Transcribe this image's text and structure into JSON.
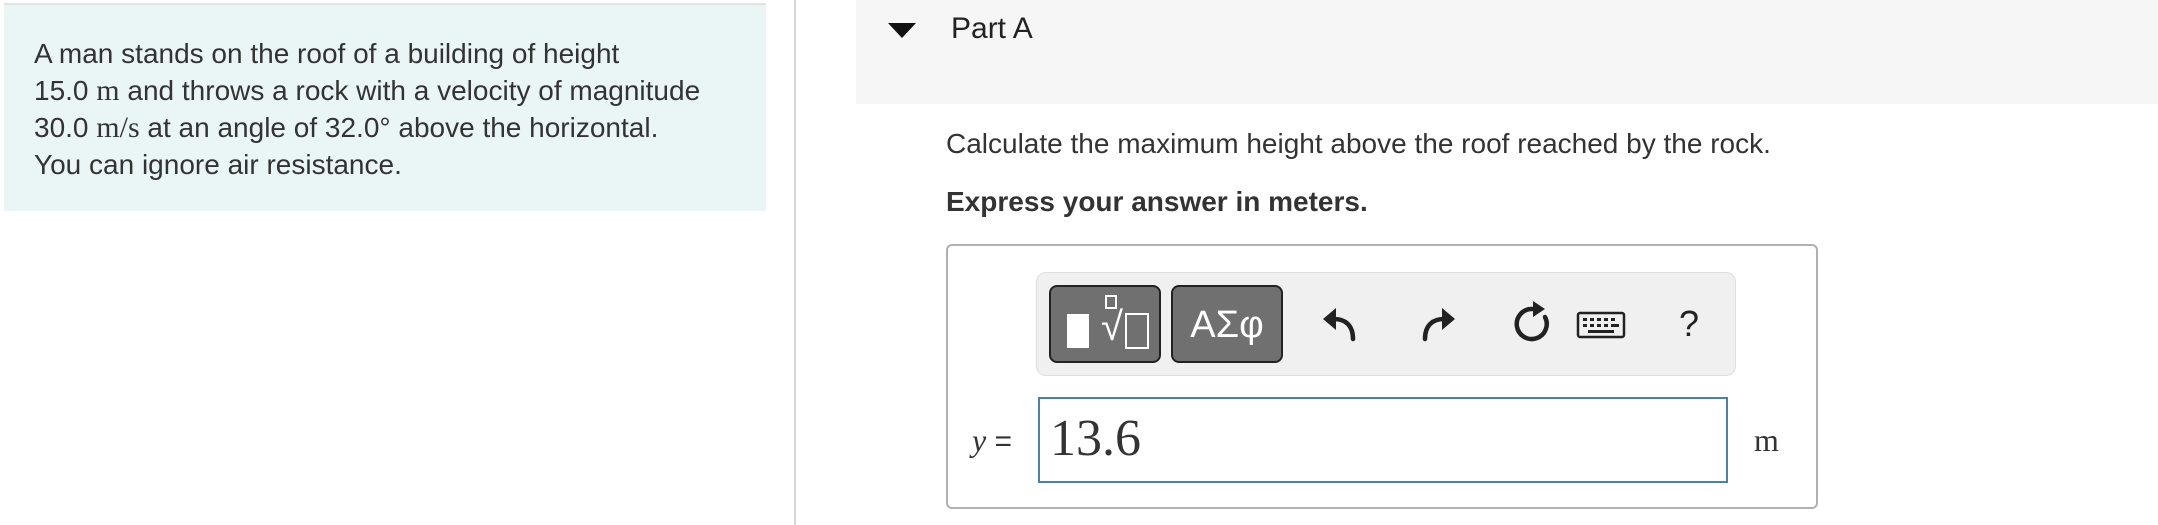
{
  "problem": {
    "line1": "A man stands on the roof of a building of height",
    "line2_value": "15.0",
    "line2_unit": "m",
    "line2_rest": "and throws a rock with a velocity of magnitude",
    "line3_value": "30.0",
    "line3_unit": "m/s",
    "line3_mid": "at an angle of",
    "line3_angle": "32.0°",
    "line3_rest": "above the horizontal.",
    "line4": "You can ignore air resistance."
  },
  "part": {
    "title": "Part A",
    "question": "Calculate the maximum height above the roof reached by the rock.",
    "instruction": "Express your answer in meters."
  },
  "toolbar": {
    "symbols_label": "ΑΣφ",
    "help_label": "?"
  },
  "answer": {
    "variable": "y",
    "equals": "=",
    "value": "13.6",
    "unit": "m"
  },
  "colors": {
    "problem_bg": "#eaf5f5",
    "header_bg": "#f6f6f6",
    "input_border": "#4a7fb0",
    "button_bg": "#707070"
  }
}
